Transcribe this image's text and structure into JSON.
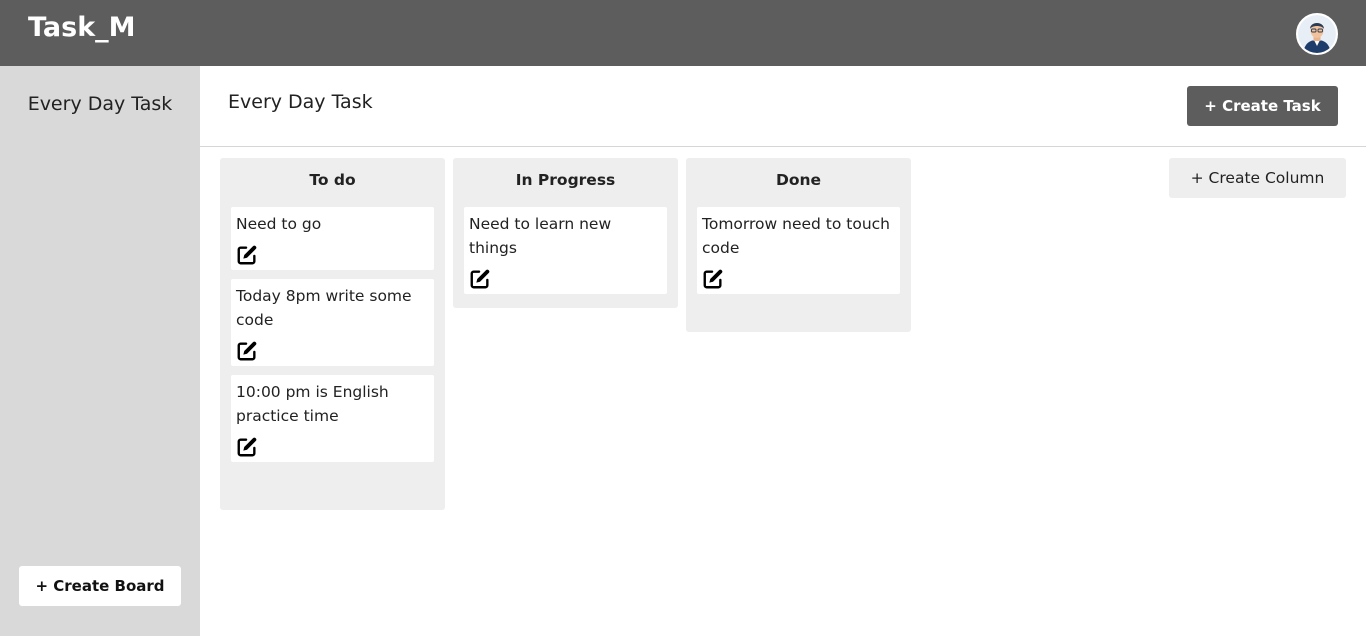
{
  "app": {
    "title": "Task_M"
  },
  "sidebar": {
    "boards": [
      {
        "label": "Every Day Task"
      }
    ],
    "create_board_label": "+ Create Board"
  },
  "header": {
    "title": "Every Day Task",
    "create_task_label": "+ Create Task"
  },
  "create_column_label": "+ Create Column",
  "columns": [
    {
      "title": "To do",
      "cards": [
        {
          "text": "Need to go"
        },
        {
          "text": "Today 8pm write some code"
        },
        {
          "text": "10:00 pm is English practice time"
        }
      ]
    },
    {
      "title": "In Progress",
      "cards": [
        {
          "text": "Need to learn new things"
        }
      ]
    },
    {
      "title": "Done",
      "cards": [
        {
          "text": "Tomorrow need to touch code"
        }
      ]
    }
  ],
  "icons": {
    "card_action": "edit-icon",
    "user": "avatar"
  },
  "colors": {
    "topbar": "#5d5d5d",
    "sidebar": "#d9d9d9",
    "column": "#eeeeee",
    "accent_button": "#5d5d5d"
  }
}
